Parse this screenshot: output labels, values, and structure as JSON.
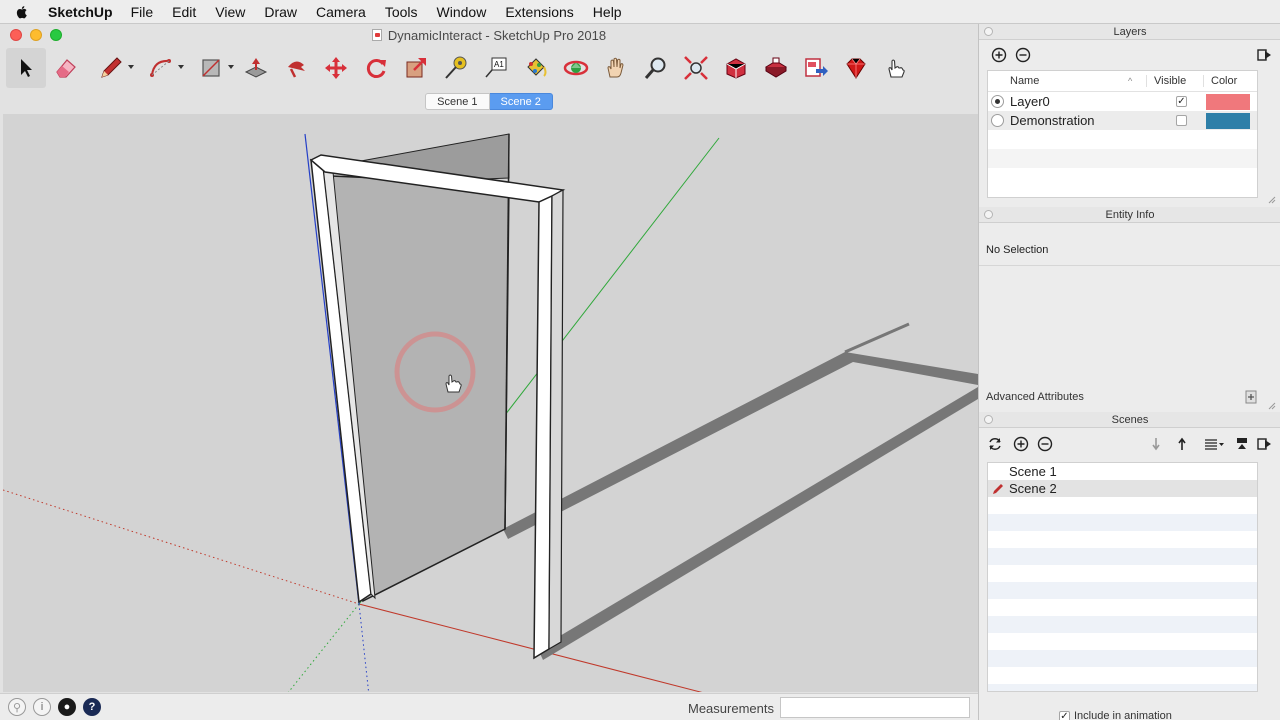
{
  "menubar": {
    "app": "SketchUp",
    "items": [
      "File",
      "Edit",
      "View",
      "Draw",
      "Camera",
      "Tools",
      "Window",
      "Extensions",
      "Help"
    ]
  },
  "window": {
    "title": "DynamicInteract - SketchUp Pro 2018"
  },
  "toolbar": {
    "tools": [
      "select",
      "eraser",
      "pencil",
      "arc",
      "rectangle",
      "push-pull",
      "follow-me",
      "move",
      "rotate",
      "scale",
      "tape-measure",
      "text",
      "paint-bucket",
      "orbit",
      "pan",
      "zoom",
      "zoom-extents",
      "warehouse",
      "extension-warehouse",
      "send-to-layout",
      "ruby",
      "interact"
    ]
  },
  "scene_tabs": [
    "Scene 1",
    "Scene 2"
  ],
  "active_scene_tab": "Scene 2",
  "statusbar": {
    "measurements_label": "Measurements",
    "measurements_value": ""
  },
  "layers": {
    "title": "Layers",
    "columns": [
      "Name",
      "Visible",
      "Color"
    ],
    "rows": [
      {
        "name": "Layer0",
        "active": true,
        "visible": true,
        "color": "#f0787c"
      },
      {
        "name": "Demonstration",
        "active": false,
        "visible": false,
        "color": "#2e7fa8"
      }
    ]
  },
  "entity_info": {
    "title": "Entity Info",
    "selection": "No Selection",
    "advanced": "Advanced Attributes"
  },
  "scenes": {
    "title": "Scenes",
    "items": [
      "Scene 1",
      "Scene 2"
    ],
    "current": "Scene 2",
    "include_in_animation": "Include in animation"
  },
  "colors": {
    "accent": "#5b9cf0",
    "axis_red": "#c0392b",
    "axis_green": "#2fa83a",
    "axis_blue": "#2540c8"
  }
}
